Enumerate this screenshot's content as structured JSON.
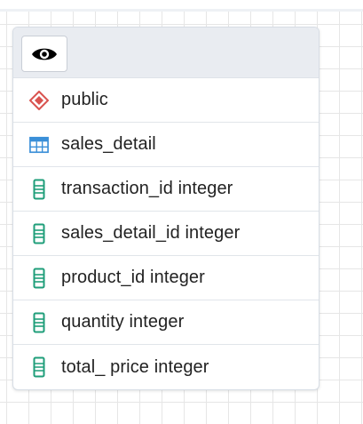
{
  "header": {
    "toggle_icon": "eye-icon"
  },
  "schema": {
    "icon": "schema-diamond-icon",
    "label": "public",
    "color": "#d9534f"
  },
  "table": {
    "icon": "table-grid-icon",
    "label": "sales_detail",
    "color": "#3a8fd8"
  },
  "columns": [
    {
      "icon": "column-icon",
      "label": "transaction_id integer"
    },
    {
      "icon": "column-icon",
      "label": "sales_detail_id integer"
    },
    {
      "icon": "column-icon",
      "label": "product_id integer"
    },
    {
      "icon": "column-icon",
      "label": "quantity integer"
    },
    {
      "icon": "column-icon",
      "label": "total_ price integer"
    }
  ],
  "column_icon_color": "#1f9e7a"
}
